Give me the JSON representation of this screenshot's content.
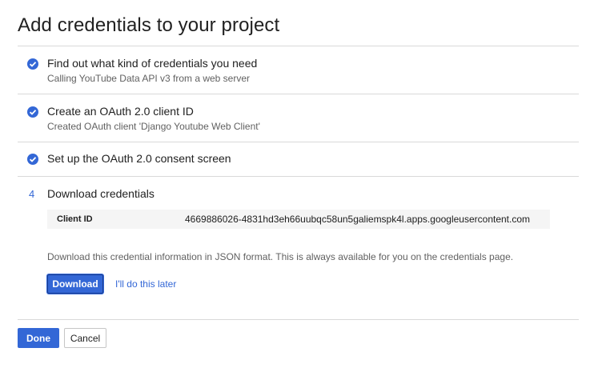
{
  "page": {
    "title": "Add credentials to your project"
  },
  "steps": [
    {
      "status": "complete",
      "icon": "check-circle-icon",
      "title": "Find out what kind of credentials you need",
      "subtitle": "Calling YouTube Data API v3 from a web server"
    },
    {
      "status": "complete",
      "icon": "check-circle-icon",
      "title": "Create an OAuth 2.0 client ID",
      "subtitle": "Created OAuth client 'Django Youtube Web Client'"
    },
    {
      "status": "complete",
      "icon": "check-circle-icon",
      "title": "Set up the OAuth 2.0 consent screen"
    },
    {
      "status": "active",
      "number": "4",
      "title": "Download credentials"
    }
  ],
  "credentials": {
    "client_id_label": "Client ID",
    "client_id_value": "4669886026-4831hd3eh66uubqc58un5galiemspk4l.apps.googleusercontent.com",
    "description": "Download this credential information in JSON format. This is always available for you on the credentials page.",
    "download_label": "Download",
    "later_label": "I'll do this later"
  },
  "footer": {
    "done_label": "Done",
    "cancel_label": "Cancel"
  },
  "colors": {
    "accent": "#3367d6",
    "divider": "#d9d9d9",
    "subtext": "#616161"
  }
}
